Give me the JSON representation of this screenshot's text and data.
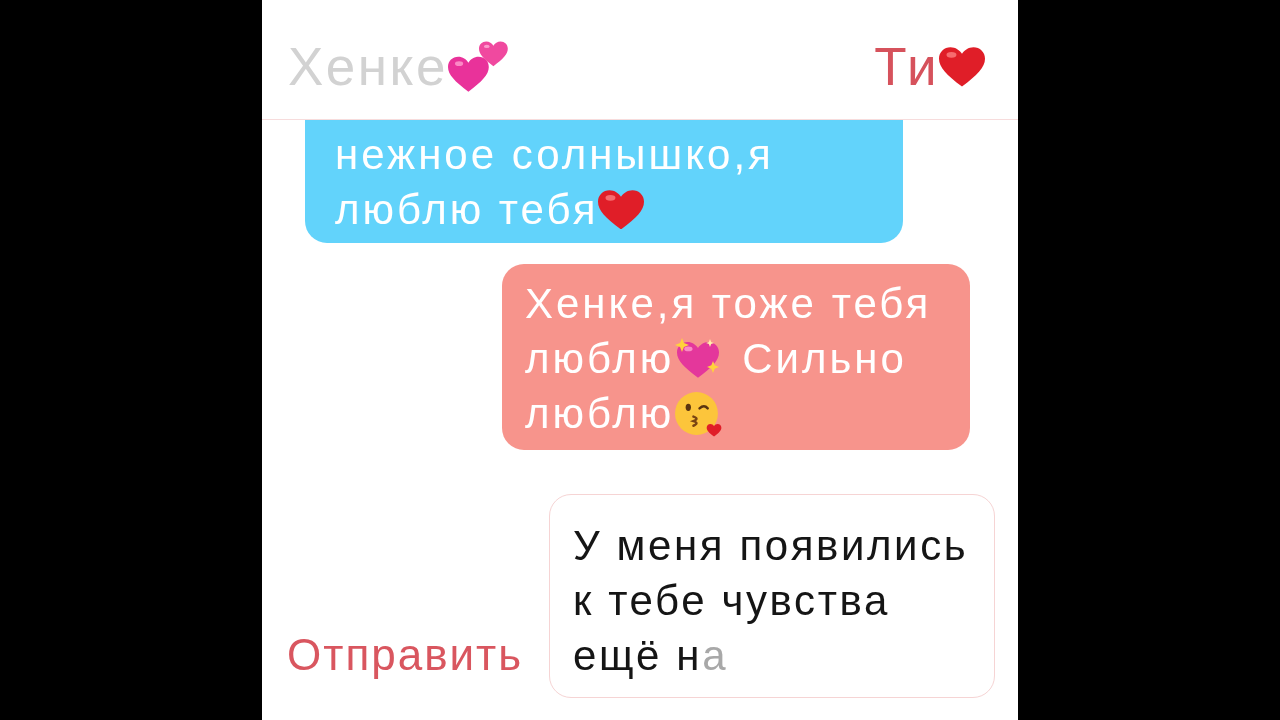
{
  "header": {
    "participants": [
      {
        "name": "Хенке",
        "emoji": {
          "kind": "two_hearts"
        },
        "selected": false
      },
      {
        "name": "Ти",
        "emoji": {
          "kind": "heart"
        },
        "selected": true
      }
    ]
  },
  "messages": [
    {
      "outgoing": false,
      "lines": [
        [
          {
            "kind": "text",
            "text": "нежное солнышко,я"
          }
        ],
        [
          {
            "kind": "text",
            "text": "люблю тебя"
          },
          {
            "kind": "heart"
          }
        ]
      ]
    },
    {
      "outgoing": true,
      "lines": [
        [
          {
            "kind": "text",
            "text": "Хенке,я тоже тебя"
          }
        ],
        [
          {
            "kind": "text",
            "text": "люблю"
          },
          {
            "kind": "sparkling_heart"
          },
          {
            "kind": "text",
            "text": "Сильно"
          }
        ],
        [
          {
            "kind": "text",
            "text": "люблю"
          },
          {
            "kind": "kissing_face"
          }
        ]
      ]
    }
  ],
  "composer": {
    "send_button": "Отправить",
    "value": "У меня появились к тебе чувства ещё н",
    "pending_text": "а"
  }
}
